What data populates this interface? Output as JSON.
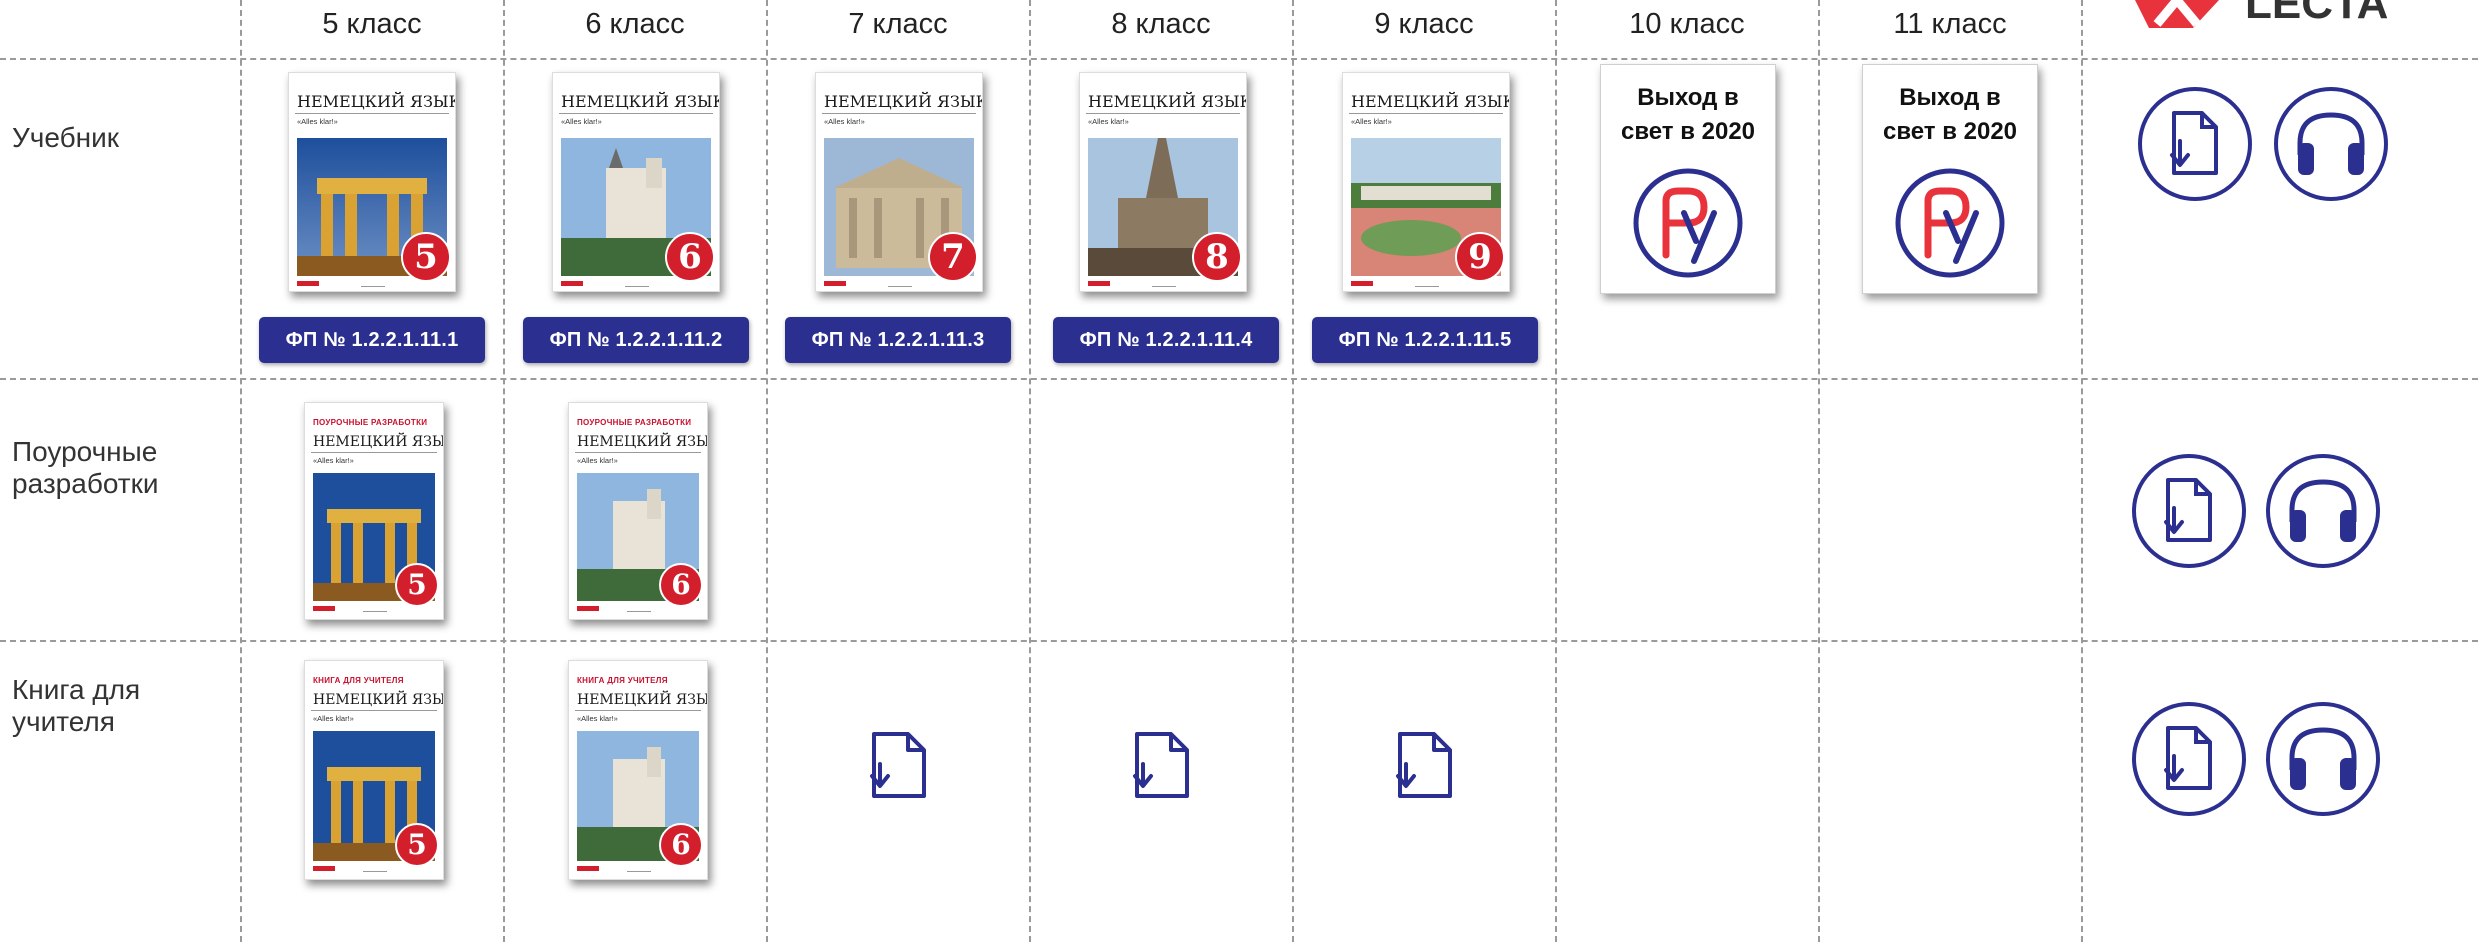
{
  "grades": [
    "5 класс",
    "6 класс",
    "7 класс",
    "8 класс",
    "9 класс",
    "10 класс",
    "11 класс"
  ],
  "rows": {
    "textbook": "Учебник",
    "lessons": "Поурочные\nразработки",
    "teacher": "Книга для\nучителя"
  },
  "book": {
    "title": "НЕМЕЦКИЙ ЯЗЫК",
    "series": "«Alles klar!»",
    "lessons_kind": "ПОУРОЧНЫЕ РАЗРАБОТКИ",
    "teacher_kind": "КНИГА ДЛЯ УЧИТЕЛЯ",
    "numbers": [
      "5",
      "6",
      "7",
      "8",
      "9"
    ]
  },
  "fp_codes": [
    "ФП № 1.2.2.1.11.1",
    "ФП № 1.2.2.1.11.2",
    "ФП № 1.2.2.1.11.3",
    "ФП № 1.2.2.1.11.4",
    "ФП № 1.2.2.1.11.5"
  ],
  "coming_soon": "Выход в\nсвет в 2020",
  "brand": {
    "name": "LECTA",
    "color": "#e8333c"
  },
  "colors": {
    "accent": "#2b2f8f",
    "red": "#d21f2b"
  },
  "icons": [
    "download-doc-icon",
    "headphones-icon",
    "ru-seal-icon"
  ]
}
